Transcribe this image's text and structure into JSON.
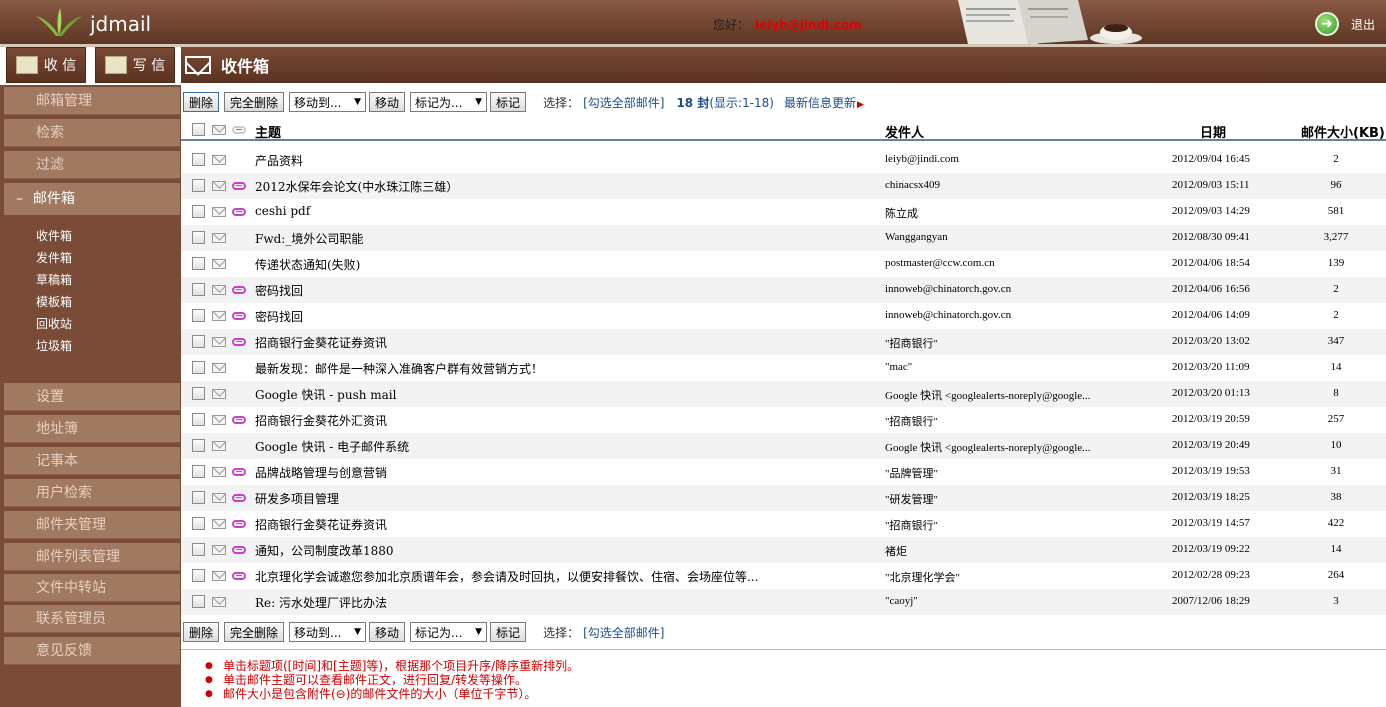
{
  "header": {
    "app_title": "jdmail",
    "greeting_label": "您好：",
    "user_email": "leiyb@jindi.com",
    "logout_label": "退出"
  },
  "actions": {
    "inbox_label": "收 信",
    "write_label": "写 信"
  },
  "page_title": "收件箱",
  "sidebar": {
    "items_top": [
      "邮箱管理",
      "检索",
      "过滤"
    ],
    "mailbox_label": "邮件箱",
    "folders": [
      "收件箱",
      "发件箱",
      "草稿箱",
      "模板箱",
      "回收站",
      "垃圾箱"
    ],
    "items_bottom": [
      "设置",
      "地址簿",
      "记事本",
      "用户检索",
      "邮件夹管理",
      "邮件列表管理",
      "文件中转站",
      "联系管理员",
      "意见反馈"
    ]
  },
  "toolbar": {
    "delete_label": "删除",
    "delete_all_label": "完全删除",
    "move_select": "移动到...",
    "move_label": "移动",
    "mark_select": "标记为...",
    "mark_label": "标记",
    "select_label": "选择：",
    "select_all_link": "[勾选全部邮件]",
    "count_text": "18 封",
    "count_sub": "(显示:1-18)",
    "refresh_link": "最新信息更新"
  },
  "table": {
    "columns": {
      "subject": "主题",
      "sender": "发件人",
      "date": "日期",
      "size": "邮件大小(KB)"
    },
    "rows": [
      {
        "subject": "产品资料",
        "sender": "leiyb@jindi.com",
        "date": "2012/09/04 16:45",
        "size": "2",
        "attach": false
      },
      {
        "subject": "2012水保年会论文(中水珠江陈三雄）",
        "sender": "chinacsx409",
        "date": "2012/09/03 15:11",
        "size": "96",
        "attach": true
      },
      {
        "subject": "ceshi pdf",
        "sender": "陈立成",
        "date": "2012/09/03 14:29",
        "size": "581",
        "attach": true
      },
      {
        "subject": "Fwd:_境外公司职能",
        "sender": "Wanggangyan",
        "date": "2012/08/30 09:41",
        "size": "3,277",
        "attach": false
      },
      {
        "subject": "传递状态通知(失败)",
        "sender": "postmaster@ccw.com.cn",
        "date": "2012/04/06 18:54",
        "size": "139",
        "attach": false
      },
      {
        "subject": "密码找回",
        "sender": "innoweb@chinatorch.gov.cn",
        "date": "2012/04/06 16:56",
        "size": "2",
        "attach": true
      },
      {
        "subject": "密码找回",
        "sender": "innoweb@chinatorch.gov.cn",
        "date": "2012/04/06 14:09",
        "size": "2",
        "attach": true
      },
      {
        "subject": "招商银行金葵花证券资讯",
        "sender": "\"招商银行\"",
        "date": "2012/03/20 13:02",
        "size": "347",
        "attach": true
      },
      {
        "subject": "最新发现：邮件是一种深入准确客户群有效营销方式！",
        "sender": "\"mac\"",
        "date": "2012/03/20 11:09",
        "size": "14",
        "attach": false
      },
      {
        "subject": "Google 快讯 - push mail",
        "sender": "Google 快讯 <googlealerts-noreply@google...",
        "date": "2012/03/20 01:13",
        "size": "8",
        "attach": false
      },
      {
        "subject": "招商银行金葵花外汇资讯",
        "sender": "\"招商银行\"",
        "date": "2012/03/19 20:59",
        "size": "257",
        "attach": true
      },
      {
        "subject": "Google 快讯 - 电子邮件系统",
        "sender": "Google 快讯 <googlealerts-noreply@google...",
        "date": "2012/03/19 20:49",
        "size": "10",
        "attach": false
      },
      {
        "subject": "品牌战略管理与创意营销",
        "sender": "\"品牌管理\"",
        "date": "2012/03/19 19:53",
        "size": "31",
        "attach": true
      },
      {
        "subject": "研发多项目管理",
        "sender": "\"研发管理\"",
        "date": "2012/03/19 18:25",
        "size": "38",
        "attach": true
      },
      {
        "subject": "招商银行金葵花证券资讯",
        "sender": "\"招商银行\"",
        "date": "2012/03/19 14:57",
        "size": "422",
        "attach": true
      },
      {
        "subject": "通知，公司制度改革1880",
        "sender": "褚炬",
        "date": "2012/03/19 09:22",
        "size": "14",
        "attach": true
      },
      {
        "subject": "北京理化学会诚邀您参加北京质谱年会，参会请及时回执，以便安排餐饮、住宿、会场座位等...",
        "sender": "\"北京理化学会\"",
        "date": "2012/02/28 09:23",
        "size": "264",
        "attach": true
      },
      {
        "subject": "Re: 污水处理厂评比办法",
        "sender": "\"caoyj\"",
        "date": "2007/12/06 18:29",
        "size": "3",
        "attach": false
      }
    ]
  },
  "notes": [
    "单击标题项([时间]和[主题]等)，根据那个项目升序/降序重新排列。",
    "单击邮件主题可以查看邮件正文，进行回复/转发等操作。",
    "邮件大小是包含附件(⊖)的邮件文件的大小（单位千字节）。"
  ]
}
